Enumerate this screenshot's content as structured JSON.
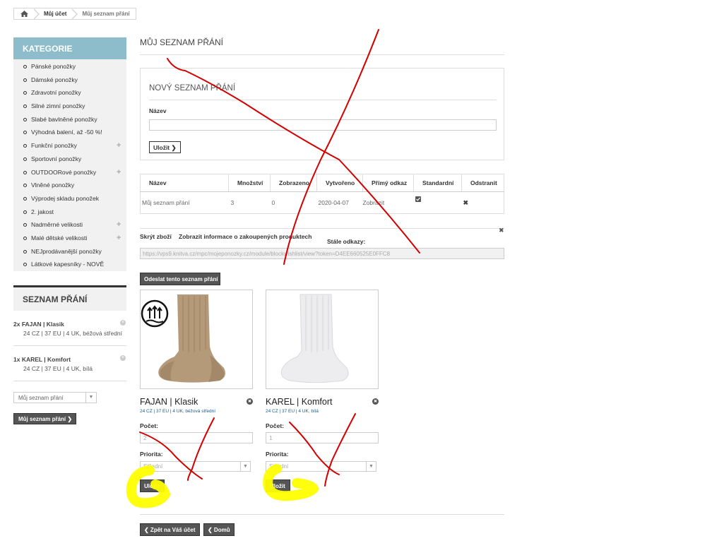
{
  "breadcrumb": {
    "home_icon": "home-icon",
    "items": [
      "Můj účet",
      "Můj seznam přání"
    ]
  },
  "sidebar": {
    "categories_title": "KATEGORIE",
    "categories": [
      "Pánské ponožky",
      "Dámské ponožky",
      "Zdravotní ponožky",
      "Silné zimní ponožky",
      "Slabé bavlněné ponožky",
      "Výhodná balení, až -50 %!",
      "Funkční ponožky",
      "Sportovní ponožky",
      "OUTDOORové ponožky",
      "Vlněné ponožky",
      "Výprodej skladu ponožek",
      "2. jakost",
      "Nadměrné velikosti",
      "Malé dětské velikosti",
      "NEJprodávanější ponožky",
      "Látkové kapesníky - NOVĚ"
    ],
    "wishlist_title": "SEZNAM PŘÁNÍ",
    "wishlist_items": [
      {
        "name": "2x FAJAN | Klasik",
        "attrs": "24 CZ | 37 EU | 4 UK, béžová střední"
      },
      {
        "name": "1x KAREL | Komfort",
        "attrs": "24 CZ | 37 EU | 4 UK, bílá"
      }
    ],
    "select_value": "Můj seznam přání",
    "button_label": "Můj seznam přání ❯"
  },
  "main": {
    "title": "MŮJ SEZNAM PŘÁNÍ",
    "new_list": {
      "title": "NOVÝ SEZNAM PŘÁNÍ",
      "name_label": "Název",
      "name_value": "",
      "save_label": "Uložit ❯"
    },
    "table": {
      "headers": [
        "Název",
        "Množství",
        "Zobrazeno",
        "Vytvořeno",
        "Přímý odkaz",
        "Standardní",
        "Odstranit"
      ],
      "row": {
        "name": "Můj seznam přání",
        "qty": "3",
        "viewed": "0",
        "created": "2020-04-07",
        "link": "Zobrazit"
      }
    },
    "options": {
      "hide": "Skrýt zboží",
      "show_info": "Zobrazit informace o zakoupených produktech",
      "permalinks": "Stále odkazy:",
      "close": "✖"
    },
    "permalink": "https://vps9.knitva.cz/mpc/mojeponozky.cz/module/blockwishlist/view?token=D4EE660525E0FFC8",
    "send_label": "Odeslat tento seznam přání",
    "products": [
      {
        "name": "FAJAN | Klasik",
        "attrs": "24 CZ | 37 EU | 4 UK, béžová střední",
        "qty_label": "Počet:",
        "qty": "2",
        "priority_label": "Priorita:",
        "priority": "Střední",
        "save_label": "Uložit"
      },
      {
        "name": "KAREL | Komfort",
        "attrs": "24 CZ | 37 EU | 4 UK, bílá",
        "qty_label": "Počet:",
        "qty": "1",
        "priority_label": "Priorita:",
        "priority": "Střední",
        "save_label": "Uložit"
      }
    ],
    "back_label": "❮ Zpět na Váš účet",
    "home_label": "❮ Domů"
  },
  "colors": {
    "category_header": "#8dbccb",
    "button_dark": "#555555",
    "annotation_red": "#d40000",
    "highlight_yellow": "#ffff00"
  }
}
